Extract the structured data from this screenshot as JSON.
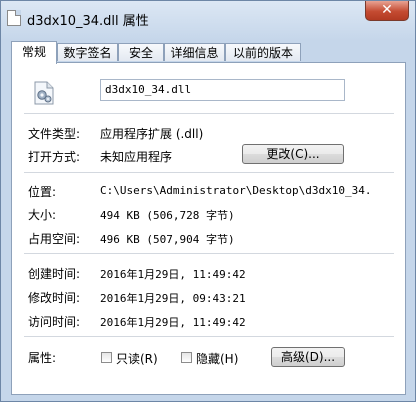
{
  "window": {
    "title": "d3dx10_34.dll 属性",
    "close_label": "✕"
  },
  "tabs": [
    {
      "label": "常规",
      "active": true
    },
    {
      "label": "数字签名",
      "active": false
    },
    {
      "label": "安全",
      "active": false
    },
    {
      "label": "详细信息",
      "active": false
    },
    {
      "label": "以前的版本",
      "active": false
    }
  ],
  "general": {
    "filename": "d3dx10_34.dll",
    "file_type_label": "文件类型:",
    "file_type_value": "应用程序扩展 (.dll)",
    "opens_with_label": "打开方式:",
    "opens_with_value": "未知应用程序",
    "change_button": "更改(C)...",
    "location_label": "位置:",
    "location_value": "C:\\Users\\Administrator\\Desktop\\d3dx10_34.",
    "size_label": "大小:",
    "size_value": "494 KB (506,728 字节)",
    "size_on_disk_label": "占用空间:",
    "size_on_disk_value": "496 KB (507,904 字节)",
    "created_label": "创建时间:",
    "created_value": "2016年1月29日, 11:49:42",
    "modified_label": "修改时间:",
    "modified_value": "2016年1月29日, 09:43:21",
    "accessed_label": "访问时间:",
    "accessed_value": "2016年1月29日, 11:49:42",
    "attributes_label": "属性:",
    "readonly_label": "只读(R)",
    "hidden_label": "隐藏(H)",
    "advanced_button": "高级(D)..."
  },
  "icons": {
    "title": "file-icon",
    "file": "dll-gear-file-icon"
  }
}
